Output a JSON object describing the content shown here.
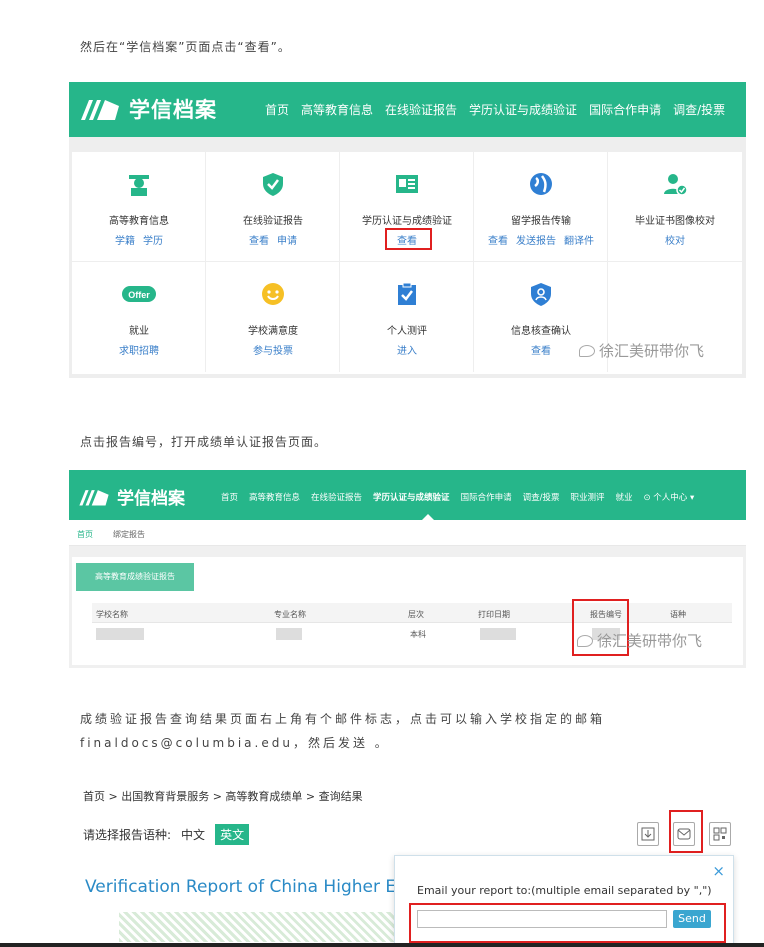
{
  "instructions": {
    "p1": "然后在“学信档案”页面点击“查看”。",
    "p2": "点击报告编号，打开成绩单认证报告页面。",
    "p3": "成绩验证报告查询结果页面右上角有个邮件标志，点击可以输入学校指定的邮箱 finaldocs@columbia.edu，然后发送 。"
  },
  "shot1": {
    "brand": "学信档案",
    "nav": [
      "首页",
      "高等教育信息",
      "在线验证报告",
      "学历认证与成绩验证",
      "国际合作申请",
      "调查/投票"
    ],
    "cells": [
      {
        "title": "高等教育信息",
        "links": [
          "学籍",
          "学历"
        ],
        "icon": "graduate-icon"
      },
      {
        "title": "在线验证报告",
        "links": [
          "查看",
          "申请"
        ],
        "icon": "shield-check-icon"
      },
      {
        "title": "学历认证与成绩验证",
        "links": [
          "查看"
        ],
        "icon": "id-card-icon"
      },
      {
        "title": "留学报告传输",
        "links": [
          "查看",
          "发送报告",
          "翻译件"
        ],
        "icon": "globe-icon"
      },
      {
        "title": "毕业证书图像校对",
        "links": [
          "校对"
        ],
        "icon": "user-check-icon"
      },
      {
        "title": "就业",
        "links": [
          "求职招聘"
        ],
        "icon": "offer-icon"
      },
      {
        "title": "学校满意度",
        "links": [
          "参与投票"
        ],
        "icon": "smile-icon"
      },
      {
        "title": "个人测评",
        "links": [
          "进入"
        ],
        "icon": "clipboard-check-icon"
      },
      {
        "title": "信息核查确认",
        "links": [
          "查看"
        ],
        "icon": "user-shield-icon"
      }
    ],
    "offer_badge": "Offer",
    "watermark": "徐汇美研带你飞"
  },
  "shot2": {
    "brand": "学信档案",
    "nav": [
      "首页",
      "高等教育信息",
      "在线验证报告",
      "学历认证与成绩验证",
      "国际合作申请",
      "调查/投票",
      "职业测评",
      "就业",
      "⊙ 个人中心 ▾"
    ],
    "crumbs": [
      "首页",
      "绑定报告"
    ],
    "tab": "高等教育成绩验证报告",
    "headers": [
      "学校名称",
      "专业名称",
      "层次",
      "打印日期",
      "报告编号",
      "语种"
    ],
    "row_level": "本科",
    "watermark": "徐汇美研带你飞"
  },
  "shot3": {
    "breadcrumb": "首页 > 出国教育背景服务 > 高等教育成绩单 > 查询结果",
    "lang_label": "请选择报告语种:",
    "lang_zh": "中文",
    "lang_en": "英文",
    "title": "Verification Report of China Higher E",
    "popup_label": "Email your report to:(multiple email separated by \",\")",
    "send": "Send",
    "close": "×"
  }
}
